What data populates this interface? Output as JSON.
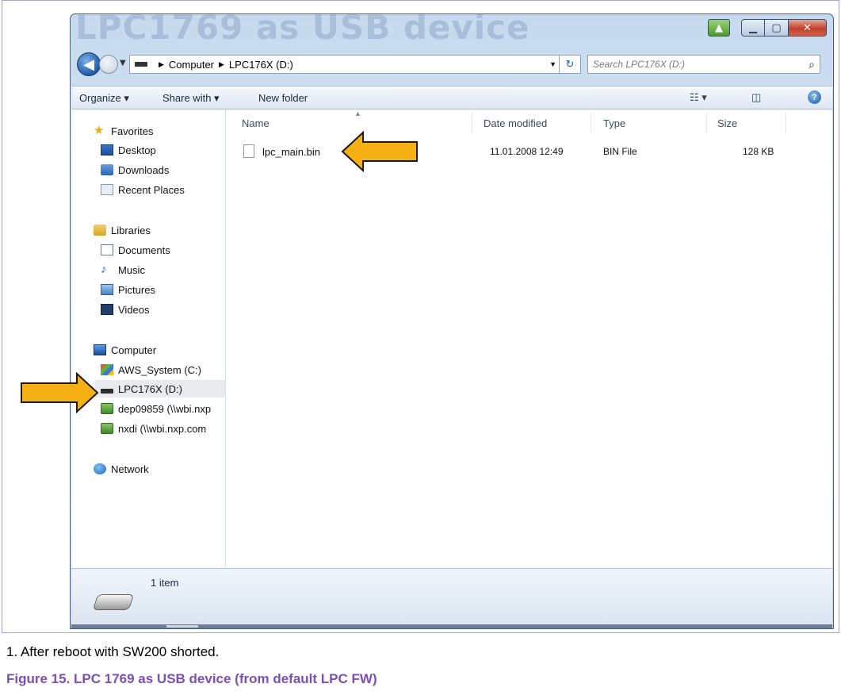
{
  "window": {
    "ghost_title": "LPC1769 as USB device",
    "address_path": [
      "Computer",
      "LPC176X (D:)"
    ],
    "search_placeholder": "Search LPC176X (D:)",
    "toolbar": {
      "organize": "Organize ▾",
      "share_with": "Share with ▾",
      "new_folder": "New folder"
    },
    "sidebar": {
      "favorites": {
        "label": "Favorites",
        "items": [
          "Desktop",
          "Downloads",
          "Recent Places"
        ]
      },
      "libraries": {
        "label": "Libraries",
        "items": [
          "Documents",
          "Music",
          "Pictures",
          "Videos"
        ]
      },
      "computer": {
        "label": "Computer",
        "items": [
          "AWS_System (C:)",
          "LPC176X (D:)",
          "dep09859 (\\\\wbi.nxp",
          "nxdi (\\\\wbi.nxp.com"
        ]
      },
      "network": {
        "label": "Network"
      }
    },
    "columns": [
      "Name",
      "Date modified",
      "Type",
      "Size"
    ],
    "files": [
      {
        "name": "lpc_main.bin",
        "date_modified": "11.01.2008 12:49",
        "type": "BIN File",
        "size": "128 KB"
      }
    ],
    "details": {
      "item_count": "1 item"
    }
  },
  "note": "1.  After reboot with SW200 shorted.",
  "figure_caption": "Figure 15.  LPC 1769 as USB device (from default LPC FW)",
  "colors": {
    "arrow_fill": "#f5b014",
    "arrow_stroke": "#1a1a1a",
    "caption": "#7b4fb4",
    "frame_border": "#a9a4c6"
  }
}
